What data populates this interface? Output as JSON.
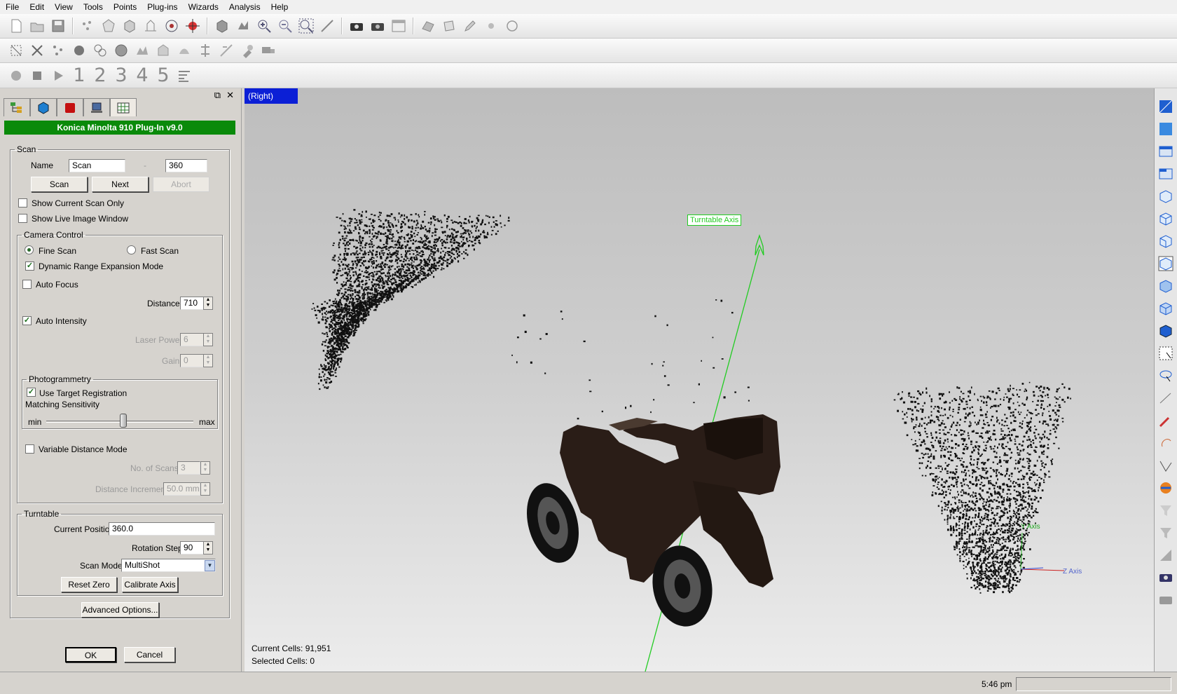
{
  "menu": [
    "File",
    "Edit",
    "View",
    "Tools",
    "Points",
    "Plug-ins",
    "Wizards",
    "Analysis",
    "Help"
  ],
  "toolbar3": {
    "numbers": [
      "1",
      "2",
      "3",
      "4",
      "5"
    ]
  },
  "panel": {
    "title": "Konica Minolta 910 Plug-In v9.0",
    "scan": {
      "legend": "Scan",
      "name_label": "Name",
      "name_value": "Scan",
      "separator": "-",
      "index_value": "360",
      "scan_btn": "Scan",
      "next_btn": "Next",
      "abort_btn": "Abort",
      "show_current": "Show Current Scan Only",
      "show_live": "Show Live Image Window"
    },
    "camera": {
      "legend": "Camera Control",
      "fine": "Fine Scan",
      "fast": "Fast Scan",
      "dynamic": "Dynamic Range Expansion Mode",
      "autofocus": "Auto Focus",
      "distance_label": "Distance",
      "distance_value": "710",
      "auto_intensity": "Auto Intensity",
      "laser_label": "Laser Power",
      "laser_value": "6",
      "gain_label": "Gain",
      "gain_value": "0"
    },
    "photogrammetry": {
      "legend": "Photogrammetry",
      "use_target": "Use Target Registration",
      "matching": "Matching Sensitivity",
      "min": "min",
      "max": "max",
      "slider_fraction": 0.55
    },
    "variable": {
      "label": "Variable Distance Mode",
      "scans_label": "No. of Scans",
      "scans_value": "3",
      "inc_label": "Distance Increment",
      "inc_value": "50.0 mm"
    },
    "turntable": {
      "legend": "Turntable",
      "pos_label": "Current Position",
      "pos_value": "360.0",
      "step_label": "Rotation Step",
      "step_value": "90",
      "mode_label": "Scan Mode",
      "mode_value": "MultiShot",
      "reset_btn": "Reset Zero",
      "calibrate_btn": "Calibrate Axis"
    },
    "advanced_btn": "Advanced Options...",
    "ok_btn": "OK",
    "cancel_btn": "Cancel"
  },
  "viewport": {
    "view_label": "(Right)",
    "axis_label": "Turntable Axis",
    "y_axis": "Y Axis",
    "z_axis": "Z Axis",
    "current_cells": "Current Cells: 91,951",
    "selected_cells": "Selected Cells: 0"
  },
  "status": {
    "time": "5:46 pm"
  },
  "colors": {
    "accent_green": "#0a8a0a",
    "view_label_bg": "#0b1fd6",
    "axis_green": "#22cc22"
  }
}
